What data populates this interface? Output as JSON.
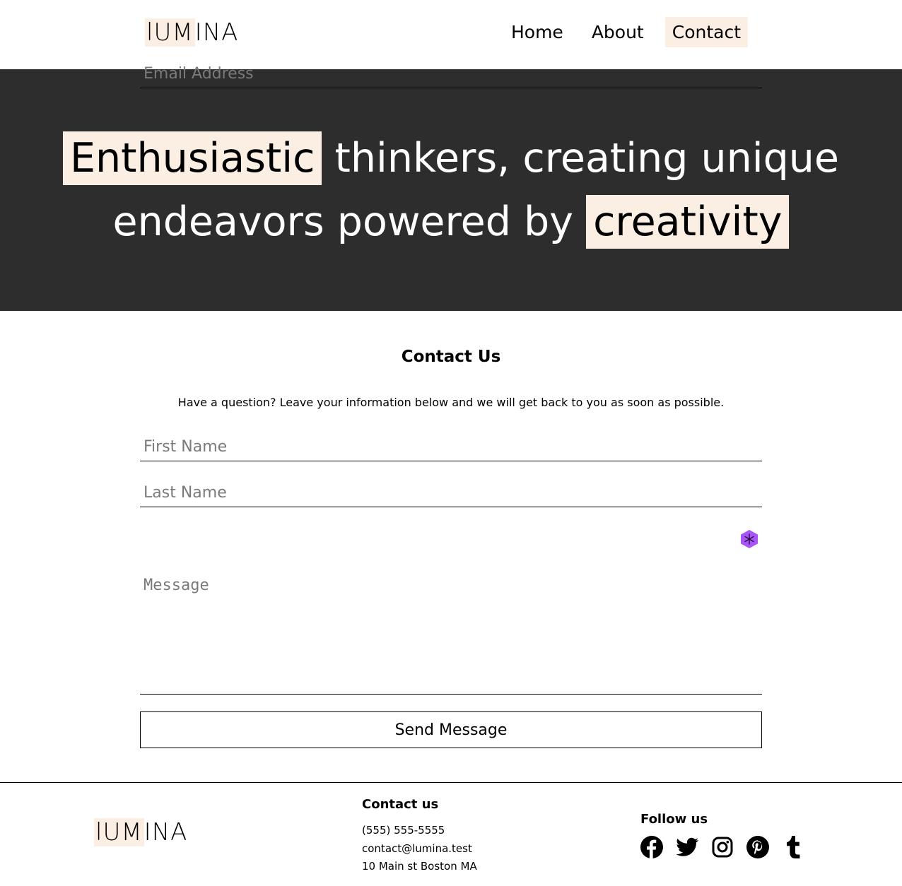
{
  "brand": {
    "logo_highlight": "lUM",
    "logo_rest": "INA"
  },
  "nav": {
    "items": [
      {
        "label": "Home"
      },
      {
        "label": "About"
      },
      {
        "label": "Contact",
        "active": true
      }
    ]
  },
  "hero": {
    "line1_highlight": "Enthusiastic",
    "line1_rest": " thinkers, creating unique",
    "line2_start": "endeavors powered by ",
    "line2_highlight": "creativity"
  },
  "contact": {
    "title": "Contact Us",
    "subtitle": "Have a question? Leave your information below and we will get back to you as soon as possible.",
    "first_name_placeholder": "First Name",
    "last_name_placeholder": "Last Name",
    "email_placeholder": "Email Address",
    "message_placeholder": "Message",
    "send_label": "Send Message"
  },
  "footer": {
    "contact_title": "Contact us",
    "phone": "(555) 555-5555",
    "email": "contact@lumina.test",
    "address": "10 Main st Boston MA",
    "follow_title": "Follow us",
    "socials": [
      "facebook-icon",
      "twitter-icon",
      "instagram-icon",
      "pinterest-icon",
      "tumblr-icon"
    ]
  },
  "colors": {
    "highlight": "#fbeee2",
    "hero_bg": "#2d2d2d",
    "extension_icon": "#a855f7"
  }
}
